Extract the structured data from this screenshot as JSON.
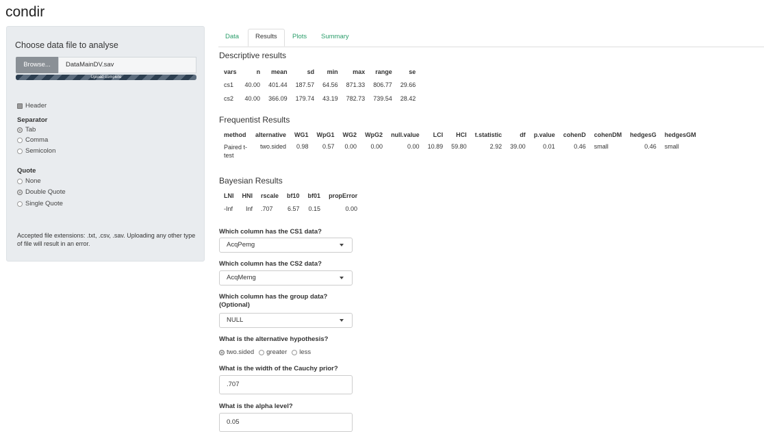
{
  "app": {
    "title": "condir"
  },
  "sidebar": {
    "heading": "Choose data file to analyse",
    "browse_label": "Browse...",
    "file_name": "DataMainDV.sav",
    "upload_status": "Upload complete",
    "header_label": "Header",
    "separator_label": "Separator",
    "separator_options": [
      "Tab",
      "Comma",
      "Semicolon"
    ],
    "quote_label": "Quote",
    "quote_options": [
      "None",
      "Double Quote",
      "Single Quote"
    ],
    "note": "Accepted file extensions: .txt, .csv, .sav. Uploading any other type of file will result in an error."
  },
  "tabs": [
    "Data",
    "Results",
    "Plots",
    "Summary"
  ],
  "descriptive": {
    "title": "Descriptive results",
    "headers": [
      "vars",
      "n",
      "mean",
      "sd",
      "min",
      "max",
      "range",
      "se"
    ],
    "rows": [
      [
        "cs1",
        "40.00",
        "401.44",
        "187.57",
        "64.56",
        "871.33",
        "806.77",
        "29.66"
      ],
      [
        "cs2",
        "40.00",
        "366.09",
        "179.74",
        "43.19",
        "782.73",
        "739.54",
        "28.42"
      ]
    ]
  },
  "frequentist": {
    "title": "Frequentist Results",
    "headers": [
      "method",
      "alternative",
      "WG1",
      "WpG1",
      "WG2",
      "WpG2",
      "null.value",
      "LCI",
      "HCI",
      "t.statistic",
      "df",
      "p.value",
      "cohenD",
      "cohenDM",
      "hedgesG",
      "hedgesGM"
    ],
    "row": [
      "Paired t-test",
      "two.sided",
      "0.98",
      "0.57",
      "0.00",
      "0.00",
      "0.00",
      "10.89",
      "59.80",
      "2.92",
      "39.00",
      "0.01",
      "0.46",
      "small",
      "0.46",
      "small"
    ]
  },
  "bayesian": {
    "title": "Bayesian Results",
    "headers": [
      "LNI",
      "HNI",
      "rscale",
      "bf10",
      "bf01",
      "propError"
    ],
    "row": [
      "-Inf",
      "Inf",
      ".707",
      "6.57",
      "0.15",
      "0.00"
    ]
  },
  "form": {
    "cs1_label": "Which column has the CS1 data?",
    "cs1_value": "AcqPemg",
    "cs2_label": "Which column has the CS2 data?",
    "cs2_value": "AcqMemg",
    "group_label_line1": "Which column has the group data?",
    "group_label_line2": "(Optional)",
    "group_value": "NULL",
    "alt_label": "What is the alternative hypothesis?",
    "alt_options": [
      "two.sided",
      "greater",
      "less"
    ],
    "cauchy_label": "What is the width of the Cauchy prior?",
    "cauchy_value": ".707",
    "alpha_label": "What is the alpha level?",
    "alpha_value": "0.05"
  }
}
